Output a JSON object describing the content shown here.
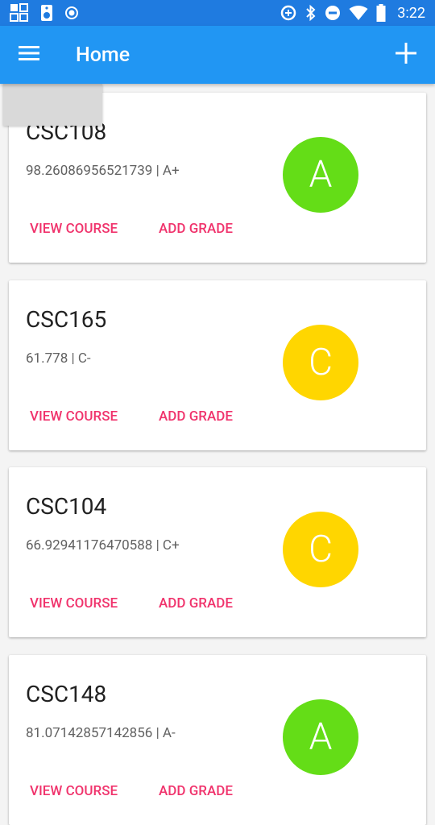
{
  "status_bar": {
    "time": "3:22",
    "left_icons": [
      "grid-icon",
      "speaker-icon",
      "record-icon"
    ],
    "right_icons": [
      "data-saver-icon",
      "bluetooth-icon",
      "do-not-disturb-icon",
      "wifi-icon",
      "battery-icon"
    ]
  },
  "app_bar": {
    "title": "Home"
  },
  "colors": {
    "status_bar": "#1f7be0",
    "app_bar": "#2196f3",
    "action_text": "#f0336c",
    "grade_a": "#64dd17",
    "grade_c": "#ffd600"
  },
  "courses": [
    {
      "name": "CSC108",
      "detail": "98.26086956521739 | A+",
      "grade_letter": "A",
      "grade_color": "#64dd17",
      "view_label": "VIEW COURSE",
      "add_label": "ADD GRADE"
    },
    {
      "name": "CSC165",
      "detail": "61.778 | C-",
      "grade_letter": "C",
      "grade_color": "#ffd600",
      "view_label": "VIEW COURSE",
      "add_label": "ADD GRADE"
    },
    {
      "name": "CSC104",
      "detail": "66.92941176470588 | C+",
      "grade_letter": "C",
      "grade_color": "#ffd600",
      "view_label": "VIEW COURSE",
      "add_label": "ADD GRADE"
    },
    {
      "name": "CSC148",
      "detail": "81.07142857142856 | A-",
      "grade_letter": "A",
      "grade_color": "#64dd17",
      "view_label": "VIEW COURSE",
      "add_label": "ADD GRADE"
    }
  ]
}
